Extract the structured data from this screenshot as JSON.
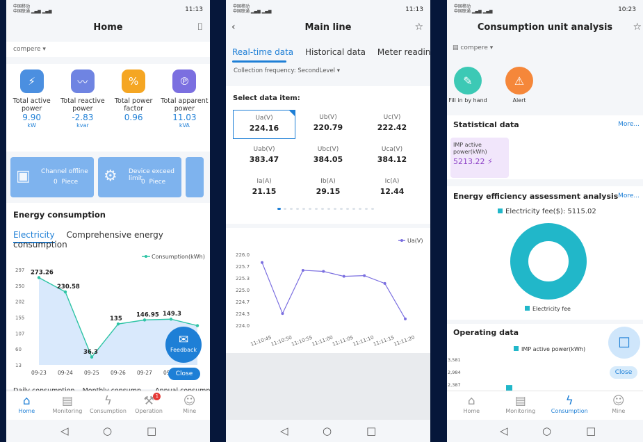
{
  "status": {
    "s1_left": "中国移动\n中国联通",
    "s1_right": "11:13",
    "s2_right": "11:13",
    "s3_right": "10:23"
  },
  "home": {
    "title": "Home",
    "filter": "compere ▾",
    "metrics": [
      {
        "label": "Total active power",
        "value": "9.90",
        "unit": "kW",
        "icon": "power-meter-icon",
        "color": "#4b8fe0"
      },
      {
        "label": "Total reactive power",
        "value": "-2.83",
        "unit": "kvar",
        "icon": "reactive-power-icon",
        "color": "#6f84e2"
      },
      {
        "label": "Total power factor",
        "value": "0.96",
        "unit": "",
        "icon": "power-factor-icon",
        "color": "#f5a623"
      },
      {
        "label": "Total apparent power",
        "value": "11.03",
        "unit": "kVA",
        "icon": "apparent-power-icon",
        "color": "#7b6fe0"
      }
    ],
    "cards": [
      {
        "title": "Channel offline",
        "value": "0",
        "unit": "Piece"
      },
      {
        "title": "Device exceed limit",
        "value": "0",
        "unit": "Piece"
      }
    ],
    "energy_title": "Energy consumption",
    "subtabs": [
      "Electricity",
      "Comprehensive energy consumption"
    ],
    "feedback": "Feedback",
    "close": "Close",
    "scrolltabs": [
      "Daily consumption",
      "Monthly consump...",
      "Annual consumpti..."
    ]
  },
  "main_line": {
    "title": "Main line",
    "tabs": [
      "Real-time data",
      "Historical data",
      "Meter reading data"
    ],
    "freq": "Collection frequency: SecondLevel ▾",
    "select_title": "Select data item:",
    "items": [
      {
        "name": "Ua(V)",
        "value": "224.16"
      },
      {
        "name": "Ub(V)",
        "value": "220.79"
      },
      {
        "name": "Uc(V)",
        "value": "222.42"
      },
      {
        "name": "Uab(V)",
        "value": "383.47"
      },
      {
        "name": "Ubc(V)",
        "value": "384.05"
      },
      {
        "name": "Uca(V)",
        "value": "384.12"
      },
      {
        "name": "Ia(A)",
        "value": "21.15"
      },
      {
        "name": "Ib(A)",
        "value": "29.15"
      },
      {
        "name": "Ic(A)",
        "value": "12.44"
      }
    ]
  },
  "analysis": {
    "title": "Consumption unit analysis",
    "filter": "compere ▾",
    "quick": [
      {
        "label": "Fill in by hand",
        "color": "#3cc9b5"
      },
      {
        "label": "Alert",
        "color": "#f5873a"
      }
    ],
    "stat_title": "Statistical data",
    "more": "More...",
    "imp_label": "IMP active power(kWh)",
    "imp_value": "5213.22",
    "eff_title": "Energy efficiency assessment analysis",
    "op_title": "Operating data",
    "close": "Close"
  },
  "tabbar": [
    {
      "label": "Home",
      "icon": "home-icon"
    },
    {
      "label": "Monitoring",
      "icon": "monitoring-icon"
    },
    {
      "label": "Consumption",
      "icon": "consumption-icon"
    },
    {
      "label": "Operation",
      "icon": "operation-icon"
    },
    {
      "label": "Mine",
      "icon": "user-icon"
    }
  ],
  "tabbar3": [
    {
      "label": "Home"
    },
    {
      "label": "Monitoring"
    },
    {
      "label": "Consumption"
    },
    {
      "label": "Mine"
    }
  ],
  "badge": "1",
  "chart_data": [
    {
      "type": "line",
      "series": [
        {
          "name": "Consumption(kWh)",
          "values": [
            273.26,
            230.58,
            36.3,
            135,
            146.95,
            149.3,
            130
          ]
        }
      ],
      "categories": [
        "09-23",
        "09-24",
        "09-25",
        "09-26",
        "09-27",
        "09-28",
        ""
      ],
      "data_labels": [
        "273.26",
        "230.58",
        "36.3",
        "135",
        "146.95",
        "149.3",
        ""
      ],
      "y_ticks": [
        "297",
        "250",
        "202",
        "155",
        "107",
        "60",
        "13"
      ],
      "ylim": [
        13,
        297
      ],
      "color": "#2ec4a5"
    },
    {
      "type": "line",
      "series": [
        {
          "name": "Ua(V)",
          "values": [
            225.77,
            224.33,
            225.55,
            225.52,
            225.38,
            225.4,
            225.18,
            224.18
          ]
        }
      ],
      "categories": [
        "11:10:45",
        "11:10:50",
        "11:10:55",
        "11:11:00",
        "11:11:05",
        "11:11:10",
        "11:11:15",
        "11:11:20"
      ],
      "y_ticks": [
        "226.0",
        "225.7",
        "225.3",
        "225.0",
        "224.7",
        "224.3",
        "224.0"
      ],
      "ylim": [
        224.0,
        226.0
      ],
      "color": "#7b6fe0"
    },
    {
      "type": "pie",
      "series": [
        {
          "name": "Electricity fee",
          "values": [
            5115.02
          ]
        }
      ],
      "legend_top": "Electricity fee($): 5115.02",
      "legend_bottom": "Electricity fee",
      "color": "#21b7c9"
    },
    {
      "type": "bar",
      "series": [
        {
          "name": "IMP active power(kWh)",
          "values": [
            2450
          ]
        }
      ],
      "y_ticks": [
        "3,581",
        "2,984",
        "2,387"
      ],
      "color": "#21b7c9"
    }
  ]
}
